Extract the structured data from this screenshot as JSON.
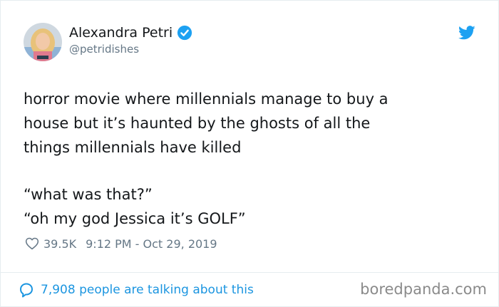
{
  "tweet": {
    "display_name": "Alexandra Petri",
    "handle": "@petridishes",
    "verified": true,
    "text_lines": [
      "horror movie where millennials manage to buy a",
      "house but it’s haunted by the ghosts of all the",
      "things millennials have killed"
    ],
    "quote_lines": [
      "“what was that?”",
      "“oh my god Jessica it’s GOLF”"
    ],
    "likes": "39.5K",
    "timestamp": "9:12 PM - Oct 29, 2019"
  },
  "footer": {
    "talking": "7,908 people are talking about this",
    "watermark": "boredpanda.com"
  },
  "icons": {
    "verified": "verified-badge-icon",
    "bird": "twitter-bird-icon",
    "heart": "heart-outline-icon",
    "bubble": "speech-bubble-icon"
  },
  "colors": {
    "accent": "#1da1f2",
    "link": "#1b95e0",
    "secondary_text": "#657786",
    "primary_text": "#14171a"
  }
}
